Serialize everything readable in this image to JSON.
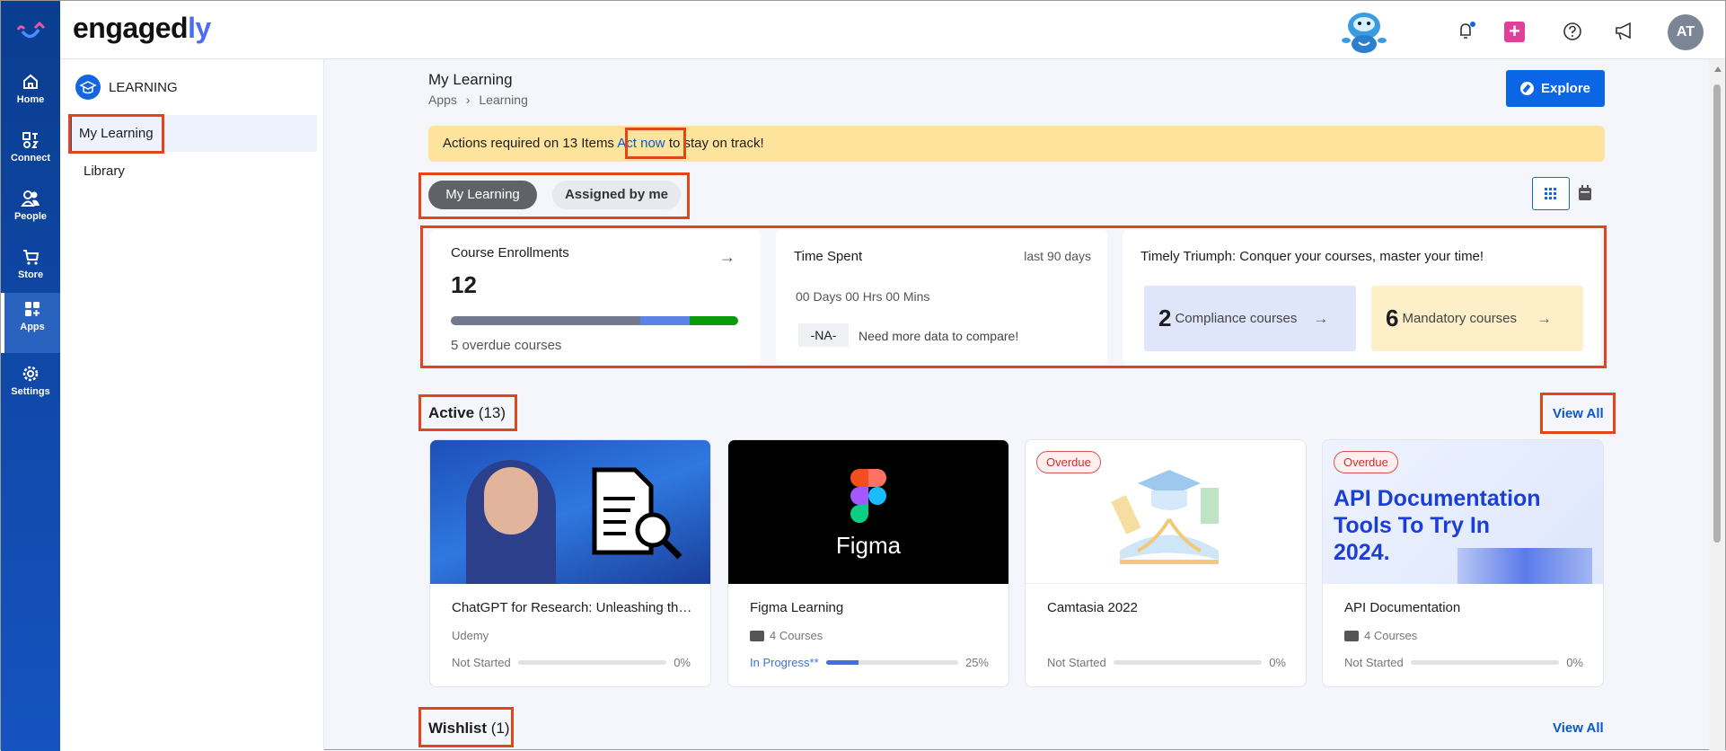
{
  "app": {
    "logo_main": "engaged",
    "logo_accent": "ly"
  },
  "leftnav": {
    "items": [
      {
        "label": "Home"
      },
      {
        "label": "Connect"
      },
      {
        "label": "People"
      },
      {
        "label": "Store"
      },
      {
        "label": "Apps"
      },
      {
        "label": "Settings"
      }
    ]
  },
  "topbar": {
    "avatar_initials": "AT"
  },
  "sidebar": {
    "section_title": "LEARNING",
    "items": [
      {
        "label": "My Learning"
      },
      {
        "label": "Library"
      }
    ]
  },
  "header": {
    "title": "My Learning",
    "breadcrumb": [
      "Apps",
      "Learning"
    ],
    "explore_label": "Explore"
  },
  "banner": {
    "prefix": "Actions required on 13 Items",
    "link": "Act now",
    "suffix": "to stay on track!"
  },
  "tabs": [
    {
      "label": "My Learning"
    },
    {
      "label": "Assigned by me"
    }
  ],
  "stats": {
    "enrollments": {
      "title": "Course Enrollments",
      "count": "12",
      "overdue": "5 overdue courses",
      "segments": [
        0.66,
        0.17,
        0.17
      ]
    },
    "time": {
      "title": "Time Spent",
      "period": "last 90 days",
      "value": "00 Days 00 Hrs 00 Mins",
      "compare_badge": "-NA-",
      "compare_text": "Need more data to compare!"
    },
    "triumph": {
      "title": "Timely Triumph: Conquer your courses, master your time!",
      "compliance_count": "2",
      "compliance_label": "Compliance courses",
      "mandatory_count": "6",
      "mandatory_label": "Mandatory courses"
    }
  },
  "active": {
    "title": "Active",
    "count": "(13)",
    "view_all": "View All"
  },
  "courses": [
    {
      "title": "ChatGPT for Research: Unleashing the Power of AI",
      "meta": "Udemy",
      "status": "Not Started",
      "percent": "0%",
      "progress": 0
    },
    {
      "title": "Figma Learning",
      "meta": "4 Courses",
      "status": "In Progress**",
      "percent": "25%",
      "progress": 25,
      "image_text": "Figma"
    },
    {
      "title": "Camtasia 2022",
      "badge": "Overdue",
      "status": "Not Started",
      "percent": "0%",
      "progress": 0
    },
    {
      "title": "API Documentation",
      "meta": "4 Courses",
      "badge": "Overdue",
      "status": "Not Started",
      "percent": "0%",
      "progress": 0,
      "image_text": "API Documentation Tools To Try In 2024."
    }
  ],
  "wishlist": {
    "title": "Wishlist",
    "count": "(1)",
    "view_all": "View All"
  },
  "colors": {
    "primary": "#0a66e4",
    "nav": "#0a3d8f",
    "banner": "#fde39b",
    "overdue": "#c9302c"
  }
}
